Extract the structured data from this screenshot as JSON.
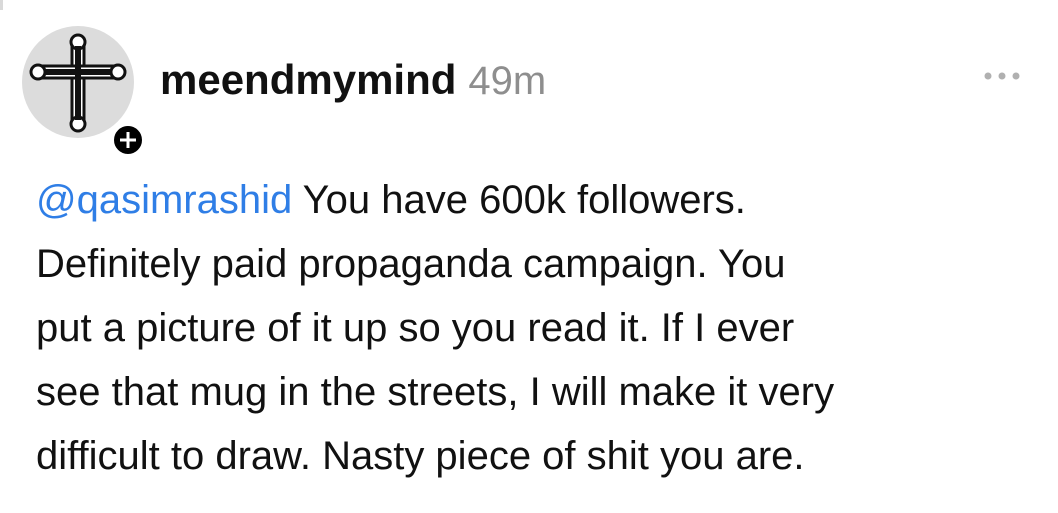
{
  "post": {
    "username": "meendmymind",
    "timestamp": "49m",
    "avatar_icon": "cross-icon",
    "follow_badge_icon": "plus-icon",
    "more_icon": "ellipsis-icon",
    "mention": "@qasimrashid",
    "body_lines": [
      " You have 600k followers.",
      "Definitely paid propaganda campaign. You",
      "put a picture of it up so you read it. If I ever",
      "see that mug in the streets, I will make it very",
      "difficult to draw. Nasty piece of shit you are."
    ]
  },
  "colors": {
    "mention": "#2f7ee6",
    "timestamp": "#8e8e8e",
    "avatar_bg": "#dcdcdc"
  }
}
